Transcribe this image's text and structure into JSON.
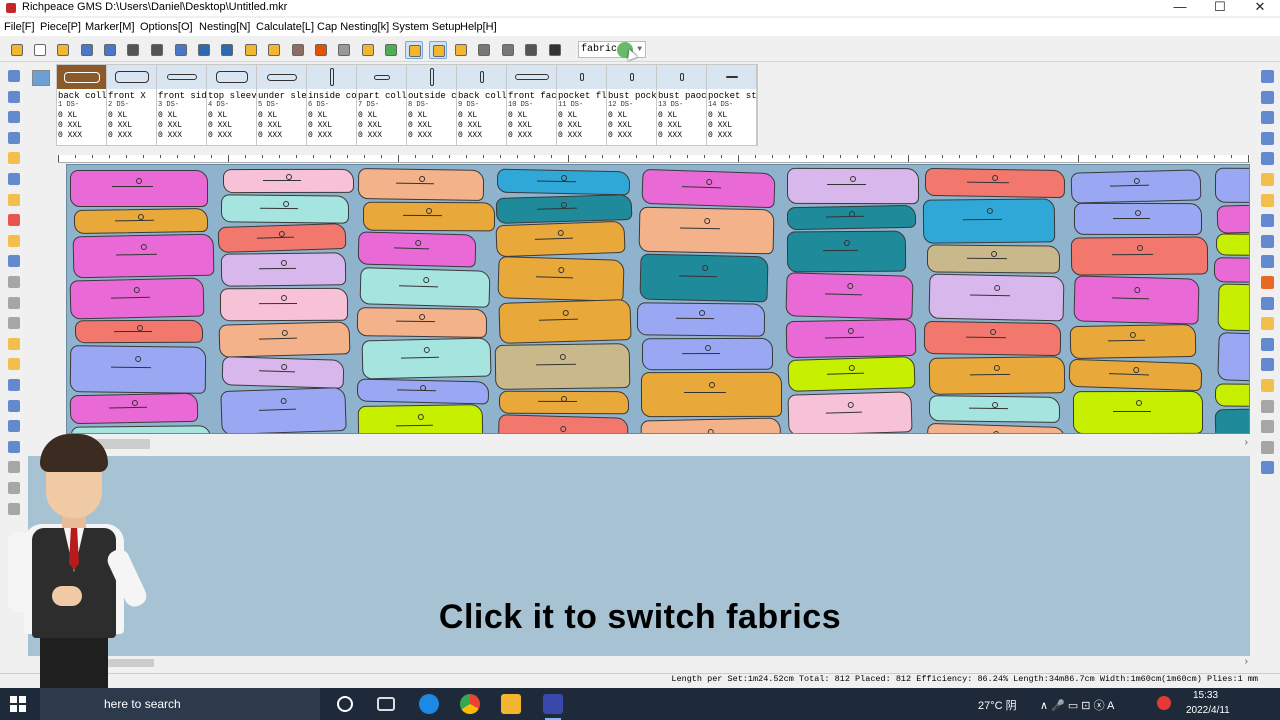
{
  "window": {
    "title": "Richpeace GMS D:\\Users\\Daniel\\Desktop\\Untitled.mkr",
    "minimize": "—",
    "maximize": "☐",
    "close": "✕"
  },
  "menu": [
    "File[F]",
    "Piece[P]",
    "Marker[M]",
    "Options[O]",
    "Nesting[N]",
    "Calculate[L]",
    "Cap Nesting[k]",
    "System Setup",
    "Help[H]"
  ],
  "toolbar": {
    "fabric_select": "fabric",
    "icons": [
      "open-icon",
      "new-icon",
      "folder-icon",
      "save-icon",
      "save-as-icon",
      "print-icon",
      "plot-icon",
      "preview-icon",
      "undo-icon",
      "redo-icon",
      "piece-icon",
      "fold-icon",
      "tools-icon",
      "color-wheel-icon",
      "grid-icon",
      "text-icon",
      "image-icon",
      "layout-icon",
      "select-layout-icon",
      "table-icon",
      "measure-icon",
      "settings-icon",
      "nest-icon",
      "delete-icon"
    ]
  },
  "pieces": [
    {
      "name": "back coll",
      "num": "1   DS-",
      "sizes": [
        [
          "0",
          "XL"
        ],
        [
          "0",
          "XXL"
        ],
        [
          "0",
          "XXX"
        ]
      ]
    },
    {
      "name": "front  X",
      "num": "2   DS-",
      "sizes": [
        [
          "0",
          "XL"
        ],
        [
          "0",
          "XXL"
        ],
        [
          "0",
          "XXX"
        ]
      ]
    },
    {
      "name": "front sid",
      "num": "3   DS-",
      "sizes": [
        [
          "0",
          "XL"
        ],
        [
          "0",
          "XXL"
        ],
        [
          "0",
          "XXX"
        ]
      ]
    },
    {
      "name": "top sleev",
      "num": "4   DS-",
      "sizes": [
        [
          "0",
          "XL"
        ],
        [
          "0",
          "XXL"
        ],
        [
          "0",
          "XXX"
        ]
      ]
    },
    {
      "name": "under sle",
      "num": "5   DS-",
      "sizes": [
        [
          "0",
          "XL"
        ],
        [
          "0",
          "XXL"
        ],
        [
          "0",
          "XXX"
        ]
      ]
    },
    {
      "name": "inside co",
      "num": "6   DS-",
      "sizes": [
        [
          "0",
          "XL"
        ],
        [
          "0",
          "XXL"
        ],
        [
          "0",
          "XXX"
        ]
      ]
    },
    {
      "name": "part coll",
      "num": "7   DS-",
      "sizes": [
        [
          "0",
          "XL"
        ],
        [
          "0",
          "XXL"
        ],
        [
          "0",
          "XXX"
        ]
      ]
    },
    {
      "name": "outside c",
      "num": "8   DS-",
      "sizes": [
        [
          "0",
          "XL"
        ],
        [
          "0",
          "XXL"
        ],
        [
          "0",
          "XXX"
        ]
      ]
    },
    {
      "name": "back coll",
      "num": "9   DS-",
      "sizes": [
        [
          "0",
          "XL"
        ],
        [
          "0",
          "XXL"
        ],
        [
          "0",
          "XXX"
        ]
      ]
    },
    {
      "name": "front fac",
      "num": "10  DS-",
      "sizes": [
        [
          "0",
          "XL"
        ],
        [
          "0",
          "XXL"
        ],
        [
          "0",
          "XXX"
        ]
      ]
    },
    {
      "name": "pocket fl",
      "num": "11  DS-",
      "sizes": [
        [
          "0",
          "XL"
        ],
        [
          "0",
          "XXL"
        ],
        [
          "0",
          "XXX"
        ]
      ]
    },
    {
      "name": "bust pock",
      "num": "12  DS-",
      "sizes": [
        [
          "0",
          "XL"
        ],
        [
          "0",
          "XXL"
        ],
        [
          "0",
          "XXX"
        ]
      ]
    },
    {
      "name": "bust paoc",
      "num": "13  DS-",
      "sizes": [
        [
          "0",
          "XL"
        ],
        [
          "0",
          "XXL"
        ],
        [
          "0",
          "XXX"
        ]
      ]
    },
    {
      "name": "pocket st",
      "num": "14  DS-",
      "sizes": [
        [
          "0",
          "XL"
        ],
        [
          "0",
          "XXL"
        ],
        [
          "0",
          "XXX"
        ]
      ]
    }
  ],
  "status": {
    "text": "Length per Set:1m24.52cm Total: 812 Placed: 812 Efficiency: 86.24% Length:34m86.7cm Width:1m60cm(1m60cm) Plies:1  mm"
  },
  "subtitle": "Click it to switch fabrics",
  "taskbar": {
    "search": "here to search",
    "weather": "27°C 阴",
    "tray": "∧  🎤  ▭  ⊡  ⓧ  A",
    "time": "15:33",
    "date": "2022/4/11"
  },
  "colors": {
    "marker_bg": "#8fb3cc",
    "empty_bg": "#a7c2d3",
    "piece_palette": [
      "#c6f000",
      "#f2786e",
      "#c9b98a",
      "#2fa8d8",
      "#e8a83a",
      "#e96ad6",
      "#9aa7f2",
      "#1e8a9a",
      "#f4b28a",
      "#a6e4e0",
      "#f7c2d6",
      "#d8b8ec"
    ]
  }
}
